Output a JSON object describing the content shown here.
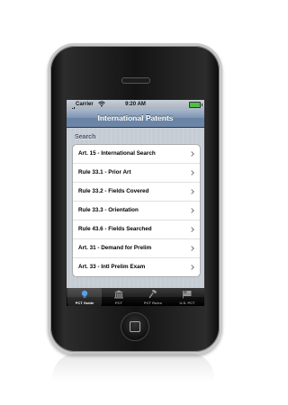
{
  "status_bar": {
    "carrier": "Carrier",
    "time": "9:20 AM"
  },
  "nav": {
    "title": "International Patents"
  },
  "section": {
    "header": "Search"
  },
  "list": {
    "items": [
      {
        "label": "Art. 15 - International Search"
      },
      {
        "label": "Rule 33.1 - Prior Art"
      },
      {
        "label": "Rule 33.2 - Fields Covered"
      },
      {
        "label": "Rule 33.3 - Orientation"
      },
      {
        "label": "Rule 43.6 - Fields Searched"
      },
      {
        "label": "Art. 31 - Demand for Prelim"
      },
      {
        "label": "Art. 33 - Intl Prelim Exam"
      }
    ]
  },
  "tabs": [
    {
      "label": "PCT Guide",
      "icon": "lightbulb-icon",
      "selected": true
    },
    {
      "label": "PCT",
      "icon": "courthouse-icon",
      "selected": false
    },
    {
      "label": "PCT Rules",
      "icon": "gavel-icon",
      "selected": false
    },
    {
      "label": "U.S. PCT",
      "icon": "flag-icon",
      "selected": false
    }
  ],
  "colors": {
    "nav_bar": "#7d95b3",
    "background": "#c5ccd4",
    "tab_bar": "#111111",
    "selected_tab_icon": "#5aa0e8"
  }
}
